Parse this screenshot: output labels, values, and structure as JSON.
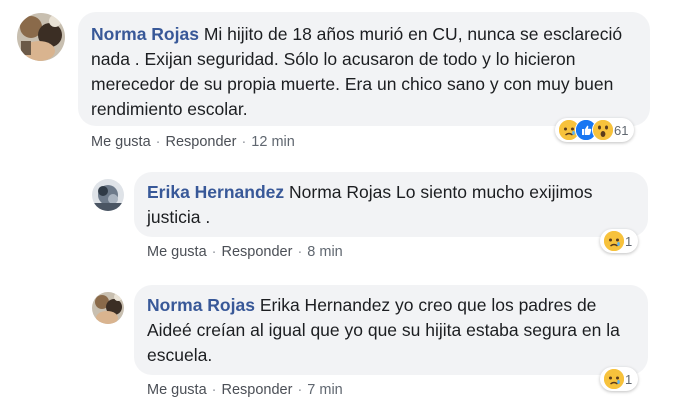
{
  "comments": [
    {
      "author": "Norma Rojas",
      "text": "Mi hijito de 18 años murió en CU, nunca se esclareció nada . Exijan seguridad. Sólo lo acusaron de todo y lo hicieron merecedor de su propia muerte. Era un chico sano y con muy buen rendimiento escolar.",
      "like_label": "Me gusta",
      "reply_label": "Responder",
      "time": "12 min",
      "reaction_icons": [
        "sad-icon",
        "like-icon",
        "wow-icon"
      ],
      "reaction_count": "61"
    },
    {
      "author": "Erika Hernandez",
      "text": "Norma Rojas Lo siento mucho exijimos justicia .",
      "like_label": "Me gusta",
      "reply_label": "Responder",
      "time": "8 min",
      "reaction_icons": [
        "sad-icon"
      ],
      "reaction_count": "1"
    },
    {
      "author": "Norma Rojas",
      "text": "Erika Hernandez yo creo que los padres de Aideé creían al igual que yo que su hijita estaba segura en la escuela.",
      "like_label": "Me gusta",
      "reply_label": "Responder",
      "time": "7 min",
      "reaction_icons": [
        "sad-icon"
      ],
      "reaction_count": "1"
    }
  ],
  "colors": {
    "author": "#385898",
    "bubble": "#f2f3f5",
    "meta": "#606770",
    "like_blue": "#1877f2",
    "emoji_yellow": "#f7c23c"
  }
}
